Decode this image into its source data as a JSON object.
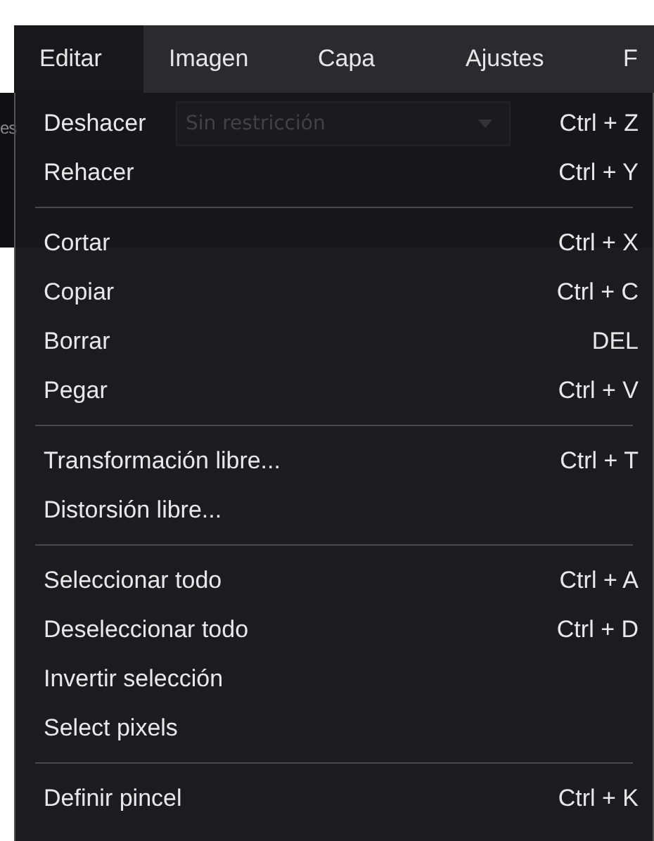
{
  "menubar": [
    {
      "label": "Editar",
      "selected": true
    },
    {
      "label": "Imagen",
      "selected": false
    },
    {
      "label": "Capa",
      "selected": false
    },
    {
      "label": "Ajustes",
      "selected": false
    },
    {
      "label": "F",
      "selected": false
    }
  ],
  "background_toolbar": {
    "label": "es",
    "dropdown_value": "Sin restricción"
  },
  "menu": {
    "groups": [
      {
        "items": [
          {
            "label": "Deshacer",
            "shortcut": "Ctrl + Z"
          },
          {
            "label": "Rehacer",
            "shortcut": "Ctrl + Y"
          }
        ]
      },
      {
        "items": [
          {
            "label": "Cortar",
            "shortcut": "Ctrl + X"
          },
          {
            "label": "Copiar",
            "shortcut": "Ctrl + C"
          },
          {
            "label": "Borrar",
            "shortcut": "DEL"
          },
          {
            "label": "Pegar",
            "shortcut": "Ctrl + V"
          }
        ]
      },
      {
        "items": [
          {
            "label": "Transformación libre...",
            "shortcut": "Ctrl + T"
          },
          {
            "label": "Distorsión libre..."
          }
        ]
      },
      {
        "items": [
          {
            "label": "Seleccionar todo",
            "shortcut": "Ctrl + A"
          },
          {
            "label": "Deseleccionar todo",
            "shortcut": "Ctrl + D"
          },
          {
            "label": "Invertir selección"
          },
          {
            "label": "Select pixels"
          }
        ]
      },
      {
        "items": [
          {
            "label": "Definir pincel",
            "shortcut": "Ctrl + K"
          }
        ]
      }
    ]
  }
}
